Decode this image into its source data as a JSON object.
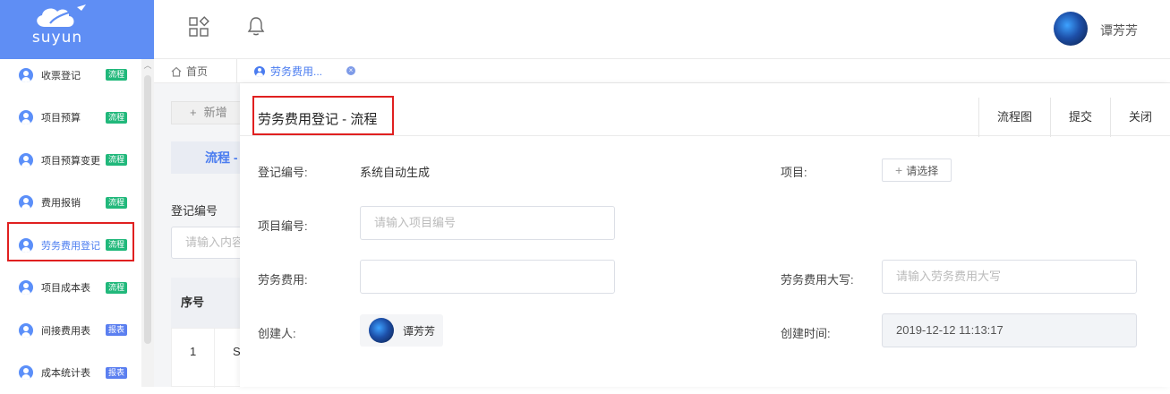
{
  "logo": {
    "text": "suyun"
  },
  "sidebar": {
    "items": [
      {
        "label": "收票登记",
        "badge": "流程",
        "badge_color": "#21b87b",
        "active": false
      },
      {
        "label": "项目预算",
        "badge": "流程",
        "badge_color": "#21b87b",
        "active": false
      },
      {
        "label": "项目预算变更",
        "badge": "流程",
        "badge_color": "#21b87b",
        "active": false
      },
      {
        "label": "费用报销",
        "badge": "流程",
        "badge_color": "#21b87b",
        "active": false
      },
      {
        "label": "劳务费用登记",
        "badge": "流程",
        "badge_color": "#21b87b",
        "active": true
      },
      {
        "label": "项目成本表",
        "badge": "流程",
        "badge_color": "#21b87b",
        "active": false
      },
      {
        "label": "间接费用表",
        "badge": "报表",
        "badge_color": "#5b7ff0",
        "active": false
      },
      {
        "label": "成本统计表",
        "badge": "报表",
        "badge_color": "#5b7ff0",
        "active": false
      }
    ]
  },
  "header": {
    "user_name": "谭芳芳",
    "apps_icon": "apps-icon",
    "bell_icon": "bell-icon"
  },
  "tabs": {
    "home": "首页",
    "active": "劳务费用..."
  },
  "background_page": {
    "new_button": "新增",
    "flow_tab": "流程 -",
    "filter_label": "登记编号",
    "filter_placeholder": "请输入内容",
    "table_header": "序号",
    "row_index": "1",
    "row_cell": "S"
  },
  "dialog": {
    "title": "劳务费用登记 - 流程",
    "actions": {
      "flowchart": "流程图",
      "submit": "提交",
      "close": "关闭"
    },
    "fields": {
      "reg_no_label": "登记编号:",
      "reg_no_value": "系统自动生成",
      "project_label": "项目:",
      "project_select": "请选择",
      "project_no_label": "项目编号:",
      "project_no_placeholder": "请输入项目编号",
      "labor_fee_label": "劳务费用:",
      "labor_fee_value": "",
      "labor_fee_upper_label": "劳务费用大写:",
      "labor_fee_upper_placeholder": "请输入劳务费用大写",
      "creator_label": "创建人:",
      "creator_name": "谭芳芳",
      "created_time_label": "创建时间:",
      "created_time_value": "2019-12-12 11:13:17"
    }
  },
  "colors": {
    "brand": "#5f8ef4",
    "accent": "#4a7cf0",
    "highlight": "#e02020"
  }
}
